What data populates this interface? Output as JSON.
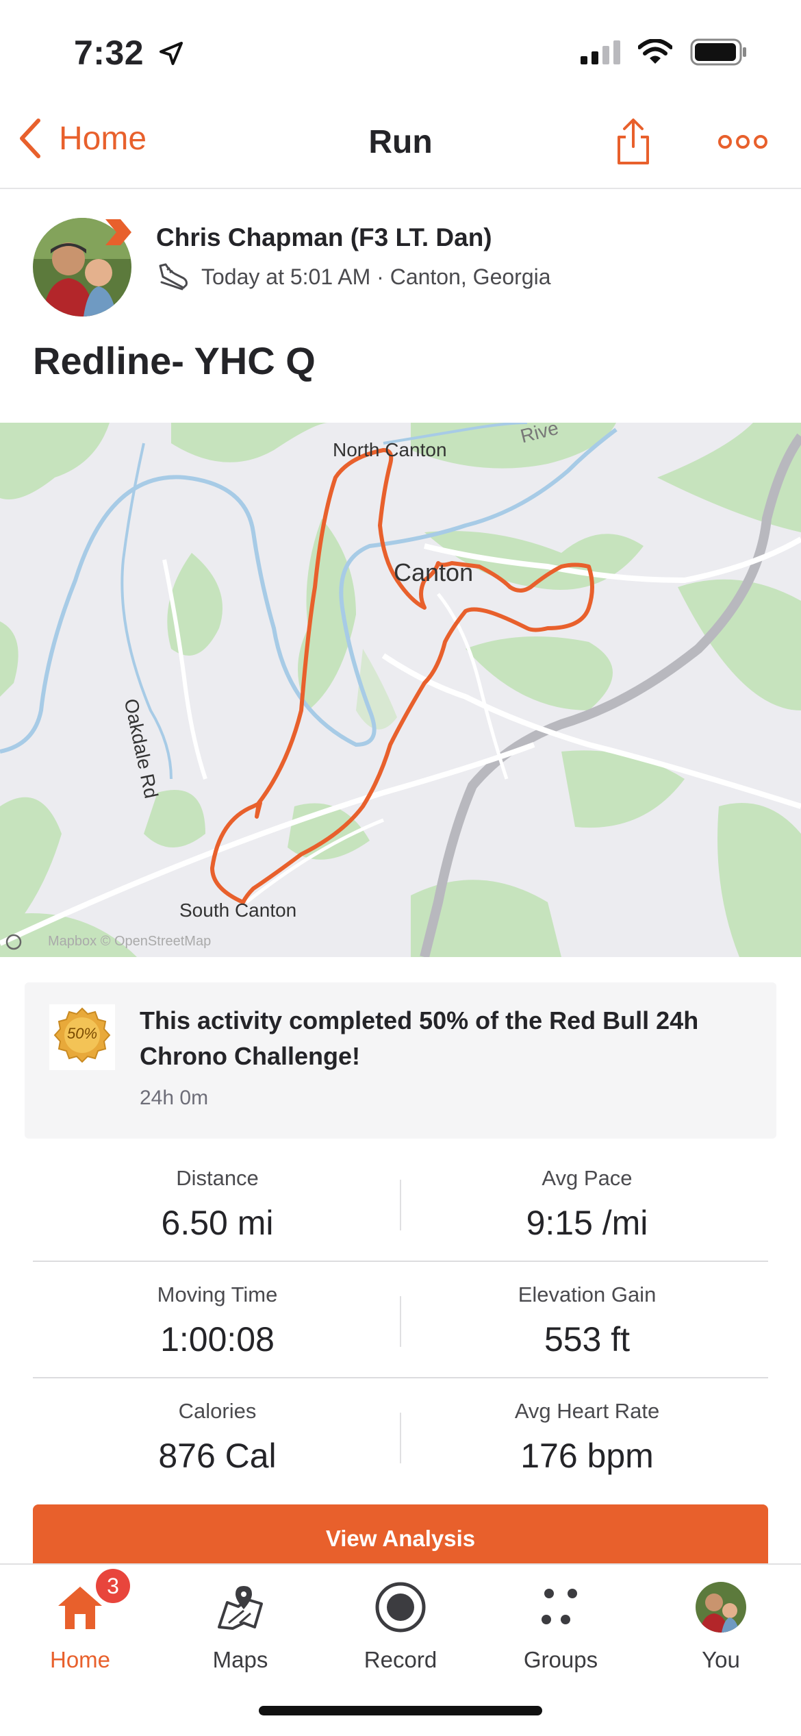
{
  "status_bar": {
    "time": "7:32"
  },
  "nav": {
    "back_label": "Home",
    "title": "Run"
  },
  "activity": {
    "athlete": "Chris Chapman (F3 LT. Dan)",
    "meta": "Today at 5:01 AM · Canton, Georgia",
    "title": "Redline- YHC Q"
  },
  "map": {
    "labels": {
      "north": "North Canton",
      "center": "Canton",
      "road": "Oakdale Rd",
      "south": "South Canton",
      "river": "Rive",
      "attribution": "Mapbox © OpenStreetMap"
    },
    "route_color": "#e8602c"
  },
  "achievement": {
    "medal_text": "50%",
    "text": "This activity completed 50% of the Red Bull 24h Chrono Challenge!",
    "sub": "24h 0m"
  },
  "stats": [
    {
      "label": "Distance",
      "value": "6.50 mi"
    },
    {
      "label": "Avg Pace",
      "value": "9:15 /mi"
    },
    {
      "label": "Moving Time",
      "value": "1:00:08"
    },
    {
      "label": "Elevation Gain",
      "value": "553 ft"
    },
    {
      "label": "Calories",
      "value": "876 Cal"
    },
    {
      "label": "Avg Heart Rate",
      "value": "176 bpm"
    }
  ],
  "button": {
    "analysis": "View Analysis"
  },
  "tabs": [
    {
      "label": "Home",
      "badge": "3",
      "icon": "home-icon"
    },
    {
      "label": "Maps",
      "icon": "maps-icon"
    },
    {
      "label": "Record",
      "icon": "record-icon"
    },
    {
      "label": "Groups",
      "icon": "groups-icon"
    },
    {
      "label": "You",
      "icon": "avatar"
    }
  ],
  "colors": {
    "accent": "#e8602c",
    "badge": "#e8453c"
  }
}
